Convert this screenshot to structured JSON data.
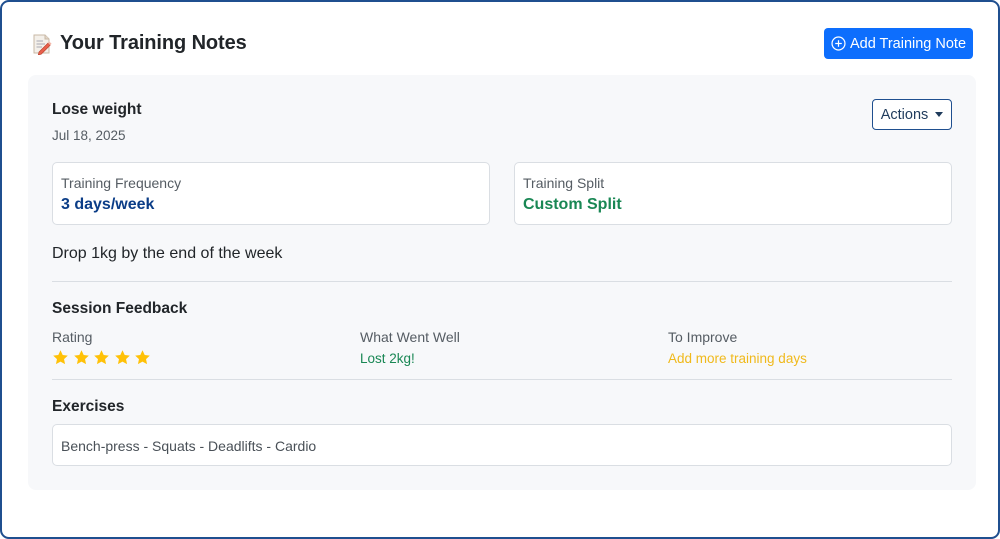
{
  "header": {
    "title": "Your Training Notes",
    "title_icon": "memo-icon",
    "add_button_label": "Add Training Note",
    "add_button_icon": "plus-circle-icon",
    "accent_color": "#0d6efd"
  },
  "note": {
    "title": "Lose weight",
    "date": "Jul 18, 2025",
    "actions_label": "Actions",
    "frequency": {
      "label": "Training Frequency",
      "value": "3 days/week",
      "color": "#0b3d87"
    },
    "split": {
      "label": "Training Split",
      "value": "Custom Split",
      "color": "#198754"
    },
    "goal": "Drop 1kg by the end of the week",
    "feedback": {
      "title": "Session Feedback",
      "rating_label": "Rating",
      "rating": 5,
      "rating_max": 5,
      "went_well_label": "What Went Well",
      "went_well": "Lost 2kg!",
      "improve_label": "To Improve",
      "improve": "Add more training days"
    },
    "exercises": {
      "title": "Exercises",
      "list": "Bench-press - Squats - Deadlifts - Cardio"
    }
  }
}
